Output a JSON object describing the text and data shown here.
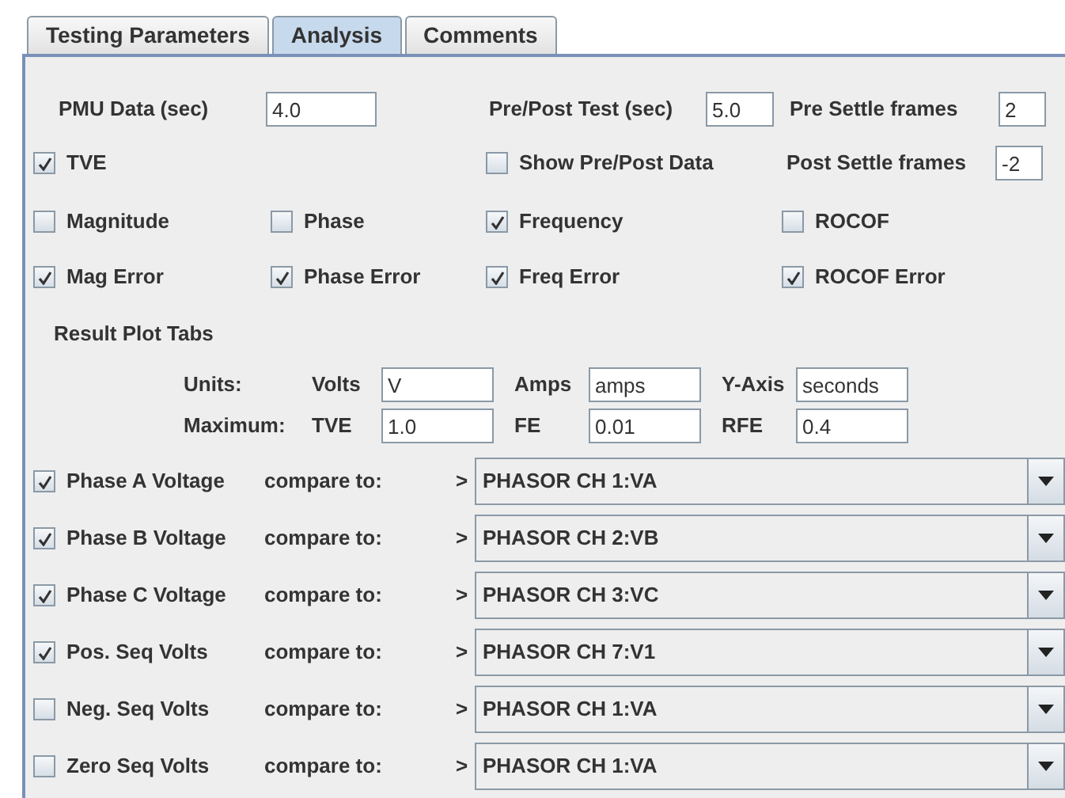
{
  "tabs": [
    {
      "label": "Testing Parameters",
      "selected": false
    },
    {
      "label": "Analysis",
      "selected": true
    },
    {
      "label": "Comments",
      "selected": false
    }
  ],
  "timing": {
    "pmu_data": {
      "label": "PMU Data (sec)",
      "value": "4.0"
    },
    "pre_post_test": {
      "label": "Pre/Post Test (sec)",
      "value": "5.0"
    },
    "pre_settle_frames": {
      "label": "Pre Settle frames",
      "value": "2"
    },
    "post_settle_frames": {
      "label": "Post Settle frames",
      "value": "-2"
    }
  },
  "options": {
    "tve": {
      "label": "TVE",
      "checked": true
    },
    "show_pre_post_data": {
      "label": "Show Pre/Post Data",
      "checked": false
    },
    "plots": [
      {
        "label": "Magnitude",
        "checked": false
      },
      {
        "label": "Phase",
        "checked": false
      },
      {
        "label": "Frequency",
        "checked": true
      },
      {
        "label": "ROCOF",
        "checked": false
      }
    ],
    "errors": [
      {
        "label": "Mag Error",
        "checked": true
      },
      {
        "label": "Phase Error",
        "checked": true
      },
      {
        "label": "Freq Error",
        "checked": true
      },
      {
        "label": "ROCOF Error",
        "checked": true
      }
    ]
  },
  "result_plot_tabs": {
    "title": "Result Plot Tabs",
    "units": {
      "label": "Units:",
      "fields": [
        {
          "label": "Volts",
          "value": "V"
        },
        {
          "label": "Amps",
          "value": "amps"
        },
        {
          "label": "Y-Axis",
          "value": "seconds"
        }
      ]
    },
    "maximum": {
      "label": "Maximum:",
      "fields": [
        {
          "label": "TVE",
          "value": "1.0"
        },
        {
          "label": "FE",
          "value": "0.01"
        },
        {
          "label": "RFE",
          "value": "0.4"
        }
      ]
    }
  },
  "comparisons": [
    {
      "label": "Phase A Voltage",
      "checked": true,
      "compare_label": "compare to:",
      "arrow": ">",
      "channel": "PHASOR CH 1:VA"
    },
    {
      "label": "Phase B Voltage",
      "checked": true,
      "compare_label": "compare to:",
      "arrow": ">",
      "channel": "PHASOR CH 2:VB"
    },
    {
      "label": "Phase C Voltage",
      "checked": true,
      "compare_label": "compare to:",
      "arrow": ">",
      "channel": "PHASOR CH 3:VC"
    },
    {
      "label": "Pos. Seq Volts",
      "checked": true,
      "compare_label": "compare to:",
      "arrow": ">",
      "channel": "PHASOR CH 7:V1"
    },
    {
      "label": "Neg. Seq Volts",
      "checked": false,
      "compare_label": "compare to:",
      "arrow": ">",
      "channel": "PHASOR CH 1:VA"
    },
    {
      "label": "Zero Seq Volts",
      "checked": false,
      "compare_label": "compare to:",
      "arrow": ">",
      "channel": "PHASOR CH 1:VA"
    }
  ]
}
